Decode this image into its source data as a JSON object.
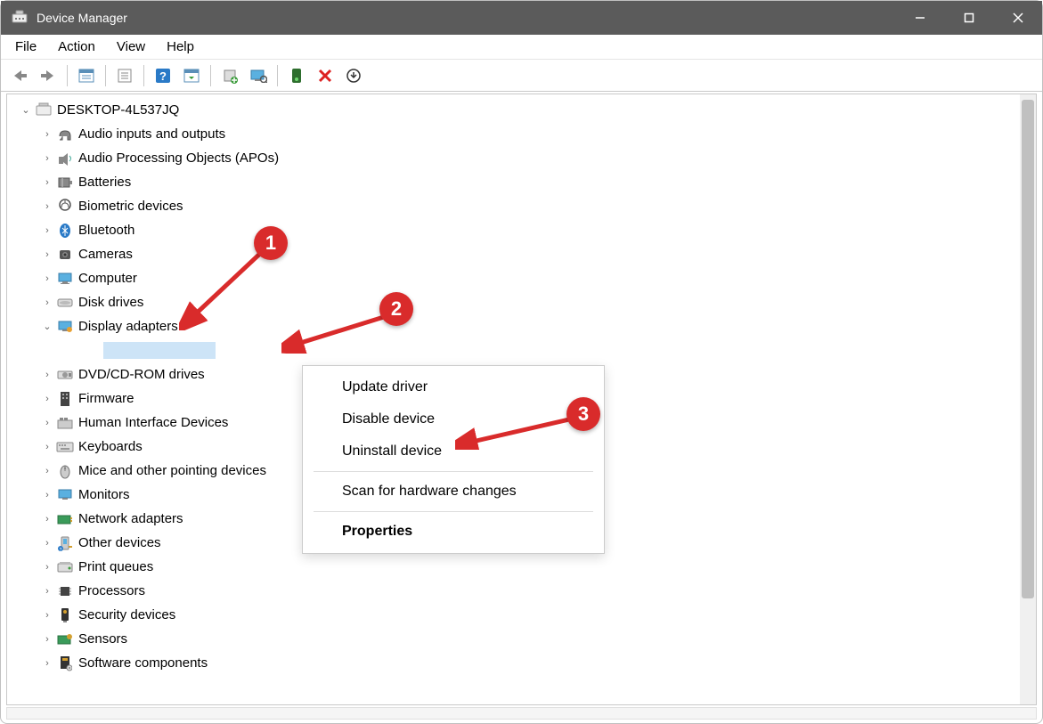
{
  "window": {
    "title": "Device Manager"
  },
  "menu": {
    "file": "File",
    "action": "Action",
    "view": "View",
    "help": "Help"
  },
  "tree": {
    "root": {
      "label": "DESKTOP-4L537JQ",
      "expanded": true
    },
    "items": [
      {
        "label": "Audio inputs and outputs"
      },
      {
        "label": "Audio Processing Objects (APOs)"
      },
      {
        "label": "Batteries"
      },
      {
        "label": "Biometric devices"
      },
      {
        "label": "Bluetooth"
      },
      {
        "label": "Cameras"
      },
      {
        "label": "Computer"
      },
      {
        "label": "Disk drives"
      },
      {
        "label": "Display adapters",
        "expanded": true,
        "child_selected": true
      },
      {
        "label": "DVD/CD-ROM drives"
      },
      {
        "label": "Firmware"
      },
      {
        "label": "Human Interface Devices"
      },
      {
        "label": "Keyboards"
      },
      {
        "label": "Mice and other pointing devices"
      },
      {
        "label": "Monitors"
      },
      {
        "label": "Network adapters"
      },
      {
        "label": "Other devices"
      },
      {
        "label": "Print queues"
      },
      {
        "label": "Processors"
      },
      {
        "label": "Security devices"
      },
      {
        "label": "Sensors"
      },
      {
        "label": "Software components"
      }
    ]
  },
  "context_menu": {
    "update_driver": "Update driver",
    "disable_device": "Disable device",
    "uninstall_device": "Uninstall device",
    "scan_hardware": "Scan for hardware changes",
    "properties": "Properties"
  },
  "annotations": {
    "step1": "1",
    "step2": "2",
    "step3": "3"
  }
}
